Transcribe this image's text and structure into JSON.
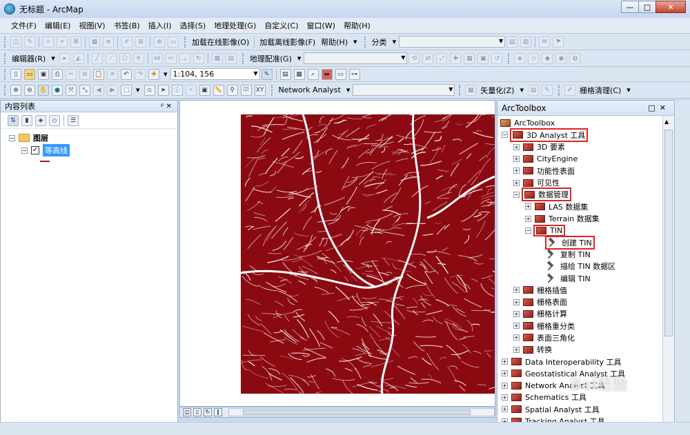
{
  "window": {
    "title": "无标题 - ArcMap",
    "controls": [
      "—",
      "□",
      "✕"
    ]
  },
  "menubar": {
    "items": [
      "文件(F)",
      "编辑(E)",
      "视图(V)",
      "书签(B)",
      "插入(I)",
      "选择(S)",
      "地理处理(G)",
      "自定义(C)",
      "窗口(W)",
      "帮助(H)"
    ]
  },
  "toolbar1": {
    "online_imagery": "加载在线影像(O)",
    "offline_imagery": "加载离线影像(F)",
    "help": "帮助(H)",
    "classify": "分类"
  },
  "toolbar2": {
    "editor": "编辑器(R)",
    "georeferencing": "地理配准(G)"
  },
  "toolbar3": {
    "scale": "1:104, 156"
  },
  "toolbar4": {
    "network_analyst": "Network Analyst",
    "vectorize": "矢量化(Z)",
    "raster_cleanup": "栅格清理(C)"
  },
  "toc": {
    "title": "内容列表",
    "pin": "ᵖ ✕",
    "layers_group": "图层",
    "layer_name": "等高线",
    "legend_color": "#9c1a1a"
  },
  "arctoolbox": {
    "title": "ArcToolbox",
    "root": "ArcToolbox",
    "items": [
      {
        "label": "3D Analyst 工具",
        "indent": 1,
        "type": "toolbox",
        "expander": "⊟",
        "highlight": true
      },
      {
        "label": "3D 要素",
        "indent": 2,
        "type": "toolset",
        "expander": "⊞"
      },
      {
        "label": "CityEngine",
        "indent": 2,
        "type": "toolset",
        "expander": "⊞"
      },
      {
        "label": "功能性表面",
        "indent": 2,
        "type": "toolset",
        "expander": "⊞"
      },
      {
        "label": "可见性",
        "indent": 2,
        "type": "toolset",
        "expander": "⊞"
      },
      {
        "label": "数据管理",
        "indent": 2,
        "type": "toolset",
        "expander": "⊟",
        "highlight": true
      },
      {
        "label": "LAS 数据集",
        "indent": 3,
        "type": "toolset",
        "expander": "⊞"
      },
      {
        "label": "Terrain 数据集",
        "indent": 3,
        "type": "toolset",
        "expander": "⊞"
      },
      {
        "label": "TIN",
        "indent": 3,
        "type": "toolset",
        "expander": "⊟",
        "highlight": true
      },
      {
        "label": "创建 TIN",
        "indent": 4,
        "type": "tool",
        "highlight": true
      },
      {
        "label": "复制 TIN",
        "indent": 4,
        "type": "tool"
      },
      {
        "label": "描绘 TIN 数据区",
        "indent": 4,
        "type": "tool"
      },
      {
        "label": "编辑 TIN",
        "indent": 4,
        "type": "tool"
      },
      {
        "label": "栅格插值",
        "indent": 2,
        "type": "toolset",
        "expander": "⊞"
      },
      {
        "label": "栅格表面",
        "indent": 2,
        "type": "toolset",
        "expander": "⊞"
      },
      {
        "label": "栅格计算",
        "indent": 2,
        "type": "toolset",
        "expander": "⊞"
      },
      {
        "label": "栅格重分类",
        "indent": 2,
        "type": "toolset",
        "expander": "⊞"
      },
      {
        "label": "表面三角化",
        "indent": 2,
        "type": "toolset",
        "expander": "⊞"
      },
      {
        "label": "转换",
        "indent": 2,
        "type": "toolset",
        "expander": "⊞"
      },
      {
        "label": "Data Interoperability 工具",
        "indent": 1,
        "type": "toolbox",
        "expander": "⊞"
      },
      {
        "label": "Geostatistical Analyst 工具",
        "indent": 1,
        "type": "toolbox",
        "expander": "⊞"
      },
      {
        "label": "Network Analyst 工具",
        "indent": 1,
        "type": "toolbox",
        "expander": "⊞"
      },
      {
        "label": "Schematics 工具",
        "indent": 1,
        "type": "toolbox",
        "expander": "⊞"
      },
      {
        "label": "Spatial Analyst 工具",
        "indent": 1,
        "type": "toolbox",
        "expander": "⊞"
      },
      {
        "label": "Tracking Analyst 工具",
        "indent": 1,
        "type": "toolbox",
        "expander": "⊞"
      }
    ]
  },
  "map": {
    "raster_color": "#8b0a12",
    "contour_color": "#ffffff"
  },
  "watermark": "Bai经验"
}
